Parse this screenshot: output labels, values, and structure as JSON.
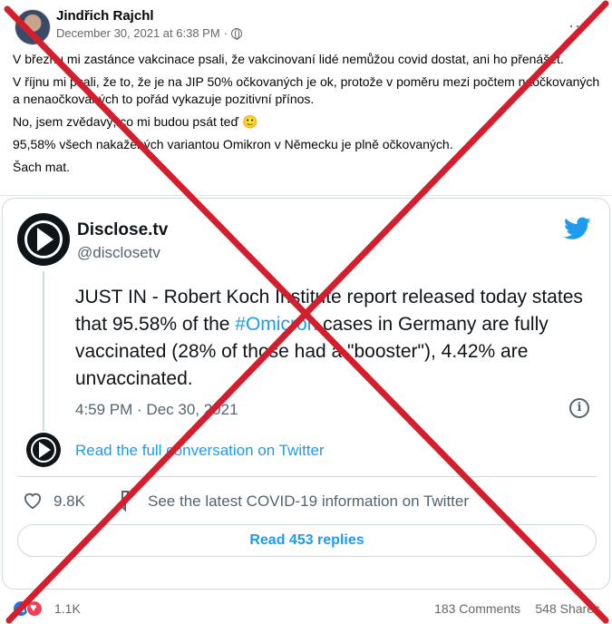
{
  "post": {
    "author": "Jindřich Rajchl",
    "timestamp": "December 30, 2021 at 6:38 PM",
    "separator": "·",
    "more": "···",
    "paragraphs": [
      "V březnu mi zastánce vakcinace psali, že vakcinovaní lidé nemůžou covid dostat, ani ho přenášet.",
      "V říjnu mi psali, že to, že je na JIP 50% očkovaných je ok, protože v poměru mezi počtem naočkovaných a nenaočkovaných to pořád vykazuje pozitivní přínos.",
      "No, jsem zvědavý, co mi budou psát teď 🙂",
      "95,58% všech nakažených variantou Omikron v Německu je plně očkovaných.",
      "Šach mat."
    ]
  },
  "tweet": {
    "name": "Disclose.tv",
    "handle": "@disclosetv",
    "body_part1": "JUST IN - Robert Koch Institute report released today states that 95.58% of the ",
    "hashtag": "#Omicron",
    "body_part2": " cases in Germany are fully vaccinated (28% of those had a \"booster\"), 4.42% are unvaccinated.",
    "time": "4:59 PM · Dec 30, 2021",
    "read_full": "Read the full conversation on Twitter",
    "likes": "9.8K",
    "covid_info": "See the latest COVID-19 information on Twitter",
    "replies_button": "Read 453 replies"
  },
  "footer": {
    "reaction_count": "1.1K",
    "comments": "183 Comments",
    "shares": "548 Shares"
  },
  "colors": {
    "twitter_blue": "#1d9bf0",
    "facebook_blue": "#1877f2",
    "cross_red": "#d31f2d"
  }
}
